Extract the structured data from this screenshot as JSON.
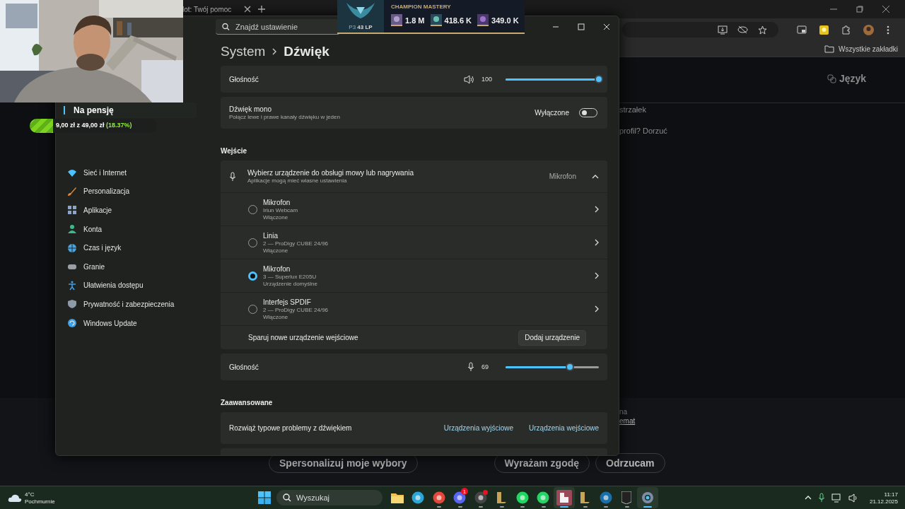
{
  "browser": {
    "tab_title": "lot: Twój pomoc",
    "bookmarks": "Wszystkie zakładki",
    "heading": "Język",
    "page_lines": [
      "strzałek",
      "profil? Dorzuć"
    ],
    "cookie_lines": [
      "na"
    ],
    "cookie_link": "emat",
    "cookie_buttons": [
      "Spersonalizuj moje wybory",
      "Wyrażam zgodę",
      "Odrzucam"
    ]
  },
  "goal": {
    "title": "Na pensję",
    "amount": "9,00 zł z 49,00 zł",
    "percent": "(18.37%)",
    "level": 0.1837
  },
  "mastery": {
    "title": "CHAMPION MASTERY",
    "rank": "P3",
    "lp": "43 LP",
    "points": [
      "1.8 M",
      "418.6 K",
      "349.0 K"
    ]
  },
  "settings": {
    "search": {
      "placeholder": "Znajdź ustawienie"
    },
    "breadcrumb": [
      "System",
      "Dźwięk"
    ],
    "sidebar": [
      {
        "label": "Sieć i Internet",
        "kind": "wifi",
        "color": "#4cc2ff"
      },
      {
        "label": "Personalizacja",
        "kind": "brush",
        "color": "#e0893a"
      },
      {
        "label": "Aplikacje",
        "kind": "apps",
        "color": "#8da4c6"
      },
      {
        "label": "Konta",
        "kind": "person",
        "color": "#3cb88f"
      },
      {
        "label": "Czas i język",
        "kind": "globe",
        "color": "#4aa3df"
      },
      {
        "label": "Granie",
        "kind": "controller",
        "color": "#9aa0a6"
      },
      {
        "label": "Ułatwienia dostępu",
        "kind": "accessibility",
        "color": "#3f9fe8"
      },
      {
        "label": "Prywatność i zabezpieczenia",
        "kind": "shield",
        "color": "#8e9aa8"
      },
      {
        "label": "Windows Update",
        "kind": "update",
        "color": "#3fa0e8"
      }
    ],
    "output_volume": {
      "label": "Głośność",
      "reading": "100",
      "level": 1.0
    },
    "mono": {
      "title": "Dźwięk mono",
      "subtitle": "Połącz lewe i prawe kanały dźwięku w jeden",
      "state_label": "Wyłączone",
      "on": false
    },
    "input_section": "Wejście",
    "input_picker": {
      "title": "Wybierz urządzenie do obsługi mowy lub nagrywania",
      "subtitle": "Aplikacje mogą mieć własne ustawienia",
      "value": "Mikrofon",
      "expanded": true
    },
    "devices": [
      {
        "name": "Mikrofon",
        "detail": "Iriun Webcam",
        "status": "Włączone",
        "selected": false
      },
      {
        "name": "Linia",
        "detail": "2 — ProDigy CUBE 24/96",
        "status": "Włączone",
        "selected": false
      },
      {
        "name": "Mikrofon",
        "detail": "3 — Superlux E205U",
        "status": "Urządzenie domyślne",
        "selected": true
      },
      {
        "name": "Interfejs SPDIF",
        "detail": "2 — ProDigy CUBE 24/96",
        "status": "Włączone",
        "selected": false
      }
    ],
    "pair": {
      "label": "Sparuj nowe urządzenie wejściowe",
      "button": "Dodaj urządzenie"
    },
    "input_volume": {
      "label": "Głośność",
      "reading": "69",
      "level": 0.69
    },
    "advanced_section": "Zaawansowane",
    "troubleshoot": {
      "label": "Rozwiąż typowe problemy z dźwiękiem",
      "links": [
        "Urządzenia wyjściowe",
        "Urządzenia wejściowe"
      ]
    }
  },
  "taskbar": {
    "weather": {
      "temp": "4°C",
      "condition": "Pochmurnie"
    },
    "search": {
      "placeholder": "Wyszukaj"
    },
    "apps": [
      {
        "kind": "folder",
        "running": false,
        "active": false
      },
      {
        "kind": "edge",
        "running": false,
        "active": false
      },
      {
        "kind": "chrome",
        "running": true,
        "active": false
      },
      {
        "kind": "discord",
        "running": true,
        "active": false,
        "badge": "1"
      },
      {
        "kind": "obs",
        "running": true,
        "active": false
      },
      {
        "kind": "league",
        "running": true,
        "active": false
      },
      {
        "kind": "spotify",
        "running": true,
        "active": false
      },
      {
        "kind": "whatsapp",
        "running": true,
        "active": false
      },
      {
        "kind": "notes",
        "running": true,
        "active": true
      },
      {
        "kind": "league",
        "running": true,
        "active": false
      },
      {
        "kind": "steam",
        "running": true,
        "active": false
      },
      {
        "kind": "epic",
        "running": true,
        "active": false
      },
      {
        "kind": "gear",
        "running": true,
        "active": true
      }
    ],
    "time": "11:17",
    "date": "21.12.2025"
  }
}
